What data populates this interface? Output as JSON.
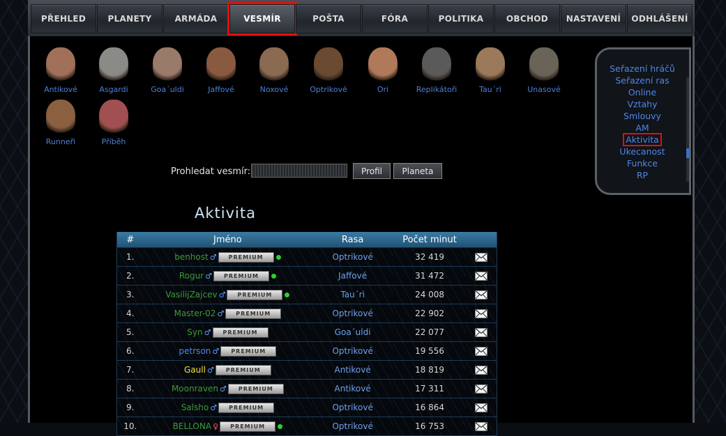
{
  "menu": [
    {
      "label": "PŘEHLED",
      "active": false
    },
    {
      "label": "PLANETY",
      "active": false
    },
    {
      "label": "ARMÁDA",
      "active": false
    },
    {
      "label": "VESMÍR",
      "active": true
    },
    {
      "label": "POŠTA",
      "active": false
    },
    {
      "label": "FÓRA",
      "active": false
    },
    {
      "label": "POLITIKA",
      "active": false
    },
    {
      "label": "OBCHOD",
      "active": false
    },
    {
      "label": "NASTAVENÍ",
      "active": false
    },
    {
      "label": "ODHLÁŠENÍ",
      "active": false
    }
  ],
  "races": [
    {
      "label": "Antikové",
      "color": "#a0705a"
    },
    {
      "label": "Asgardi",
      "color": "#8a8a86"
    },
    {
      "label": "Goa´uldi",
      "color": "#9a7a68"
    },
    {
      "label": "Jaffové",
      "color": "#8a5a40"
    },
    {
      "label": "Noxové",
      "color": "#8a6a50"
    },
    {
      "label": "Optrikové",
      "color": "#6a4a30"
    },
    {
      "label": "Ori",
      "color": "#b07a5a"
    },
    {
      "label": "Replikátoři",
      "color": "#5a5a5a"
    },
    {
      "label": "Tau´ri",
      "color": "#9a7a5a"
    },
    {
      "label": "Unasové",
      "color": "#6a6458"
    },
    {
      "label": "Runneři",
      "color": "#8a6040"
    },
    {
      "label": "Příběh",
      "color": "#a05050"
    }
  ],
  "search": {
    "label": "Prohledat vesmír:",
    "value": "",
    "profile_button": "Profil",
    "planet_button": "Planeta"
  },
  "page_title": "Aktivita",
  "table": {
    "headers": [
      "#",
      "Jméno",
      "Rasa",
      "Počet minut",
      ""
    ],
    "premium_label": "PREMIUM",
    "rows": [
      {
        "rank": "1.",
        "name": "benhost",
        "gender": "♂",
        "online": true,
        "race": "Optrikové",
        "minutes": "32 419",
        "name_color": "green"
      },
      {
        "rank": "2.",
        "name": "Rogur",
        "gender": "♂",
        "online": true,
        "race": "Jaffové",
        "minutes": "31 472",
        "name_color": "green"
      },
      {
        "rank": "3.",
        "name": "VasilijZajcev",
        "gender": "♂",
        "online": true,
        "race": "Tau´ri",
        "minutes": "24 008",
        "name_color": "green"
      },
      {
        "rank": "4.",
        "name": "Master-02",
        "gender": "♂",
        "online": false,
        "race": "Optrikové",
        "minutes": "22 902",
        "name_color": "green"
      },
      {
        "rank": "5.",
        "name": "Syn",
        "gender": "♂",
        "online": false,
        "race": "Goa´uldi",
        "minutes": "22 077",
        "name_color": "green"
      },
      {
        "rank": "6.",
        "name": "petrson",
        "gender": "♂",
        "online": false,
        "race": "Optrikové",
        "minutes": "19 556",
        "name_color": "blue"
      },
      {
        "rank": "7.",
        "name": "Gaull",
        "gender": "♂",
        "online": false,
        "race": "Antikové",
        "minutes": "18 819",
        "name_color": "yellow"
      },
      {
        "rank": "8.",
        "name": "Moonraven",
        "gender": "♂",
        "online": false,
        "race": "Antikové",
        "minutes": "17 311",
        "name_color": "green"
      },
      {
        "rank": "9.",
        "name": "Salsho",
        "gender": "♂",
        "online": false,
        "race": "Optrikové",
        "minutes": "16 864",
        "name_color": "green"
      },
      {
        "rank": "10.",
        "name": "BELLONA",
        "gender": "♀",
        "online": true,
        "race": "Optrikové",
        "minutes": "16 753",
        "name_color": "green"
      }
    ]
  },
  "side_menu": [
    {
      "label": "Seřazení hráčů",
      "active": false
    },
    {
      "label": "Seřazení ras",
      "active": false
    },
    {
      "label": "Online",
      "active": false
    },
    {
      "label": "Vztahy",
      "active": false
    },
    {
      "label": "Smlouvy",
      "active": false
    },
    {
      "label": "AM",
      "active": false
    },
    {
      "label": "Aktivita",
      "active": true
    },
    {
      "label": "Ukecanost",
      "active": false
    },
    {
      "label": "Funkce",
      "active": false
    },
    {
      "label": "RP",
      "active": false
    }
  ]
}
